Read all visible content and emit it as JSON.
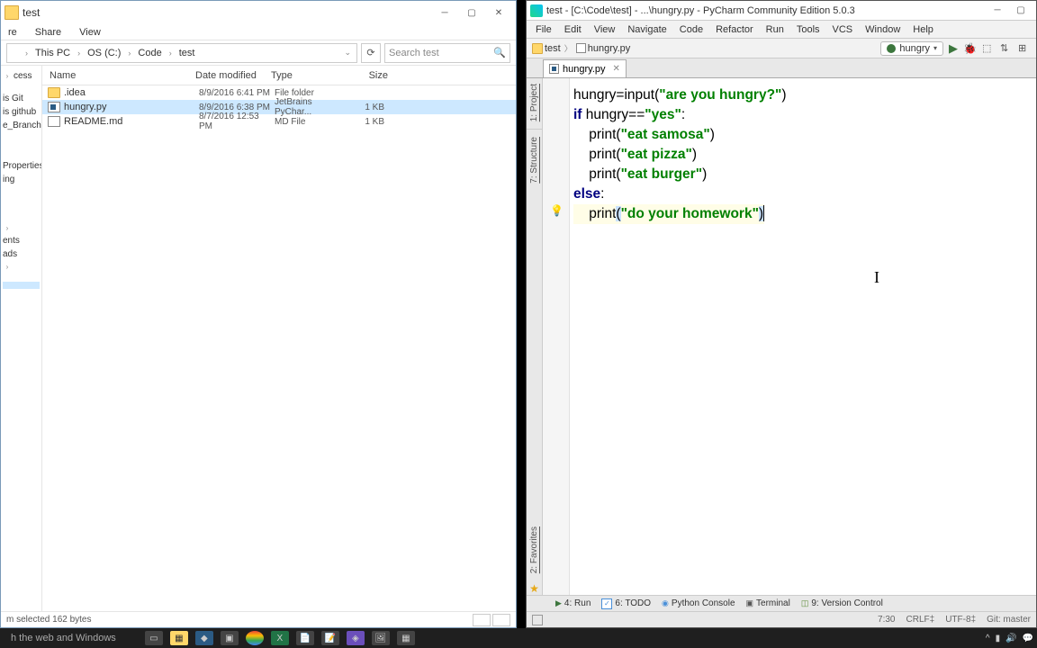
{
  "explorer": {
    "title": "test",
    "menu": [
      "re",
      "Share",
      "View"
    ],
    "breadcrumb": [
      "This PC",
      "OS (C:)",
      "Code",
      "test"
    ],
    "search_placeholder": "Search test",
    "nav_items_top": [
      "cess"
    ],
    "nav_items_mid": [
      "is Git",
      "is github",
      "e_Branch"
    ],
    "nav_items_lower": [
      "Properties",
      "ing"
    ],
    "nav_items_bottom": [
      "",
      "ents",
      "ads",
      ""
    ],
    "columns": {
      "name": "Name",
      "date": "Date modified",
      "type": "Type",
      "size": "Size"
    },
    "files": [
      {
        "name": ".idea",
        "date": "8/9/2016 6:41 PM",
        "type": "File folder",
        "size": "",
        "icon": "folder",
        "selected": false
      },
      {
        "name": "hungry.py",
        "date": "8/9/2016 6:38 PM",
        "type": "JetBrains PyChar...",
        "size": "1 KB",
        "icon": "py",
        "selected": true
      },
      {
        "name": "README.md",
        "date": "8/7/2016 12:53 PM",
        "type": "MD File",
        "size": "1 KB",
        "icon": "md",
        "selected": false
      }
    ],
    "status": "m selected  162 bytes"
  },
  "pycharm": {
    "title": "test - [C:\\Code\\test] - ...\\hungry.py - PyCharm Community Edition 5.0.3",
    "menu": [
      "File",
      "Edit",
      "View",
      "Navigate",
      "Code",
      "Refactor",
      "Run",
      "Tools",
      "VCS",
      "Window",
      "Help"
    ],
    "breadcrumb": {
      "project": "test",
      "file": "hungry.py"
    },
    "run_config": "hungry",
    "tab": "hungry.py",
    "side_tools_top": [
      "1: Project",
      "7: Structure"
    ],
    "side_tools_bottom": [
      "2: Favorites"
    ],
    "code": {
      "l1": {
        "a": "hungry",
        "b": "=",
        "c": "input",
        "d": "(",
        "e": "\"are you hungry?\"",
        "f": ")"
      },
      "l2": {
        "a": "if",
        "b": " hungry",
        "c": "==",
        "d": "\"yes\"",
        "e": ":"
      },
      "l3": {
        "a": "    ",
        "b": "print",
        "c": "(",
        "d": "\"eat samosa\"",
        "e": ")"
      },
      "l4": {
        "a": "    ",
        "b": "print",
        "c": "(",
        "d": "\"eat pizza\"",
        "e": ")"
      },
      "l5": {
        "a": "    ",
        "b": "print",
        "c": "(",
        "d": "\"eat burger\"",
        "e": ")"
      },
      "l6": {
        "a": "else",
        "b": ":"
      },
      "l7": {
        "a": "    ",
        "b": "print",
        "c": "(",
        "d": "\"do your homework\"",
        "e": ")"
      }
    },
    "bottom_tools": [
      "4: Run",
      "6: TODO",
      "Python Console",
      "Terminal",
      "9: Version Control"
    ],
    "status": {
      "pos": "7:30",
      "crlf": "CRLF‡",
      "enc": "UTF-8‡",
      "git": "Git: master"
    }
  },
  "taskbar": {
    "search": "h the web and Windows",
    "tray": "^"
  }
}
